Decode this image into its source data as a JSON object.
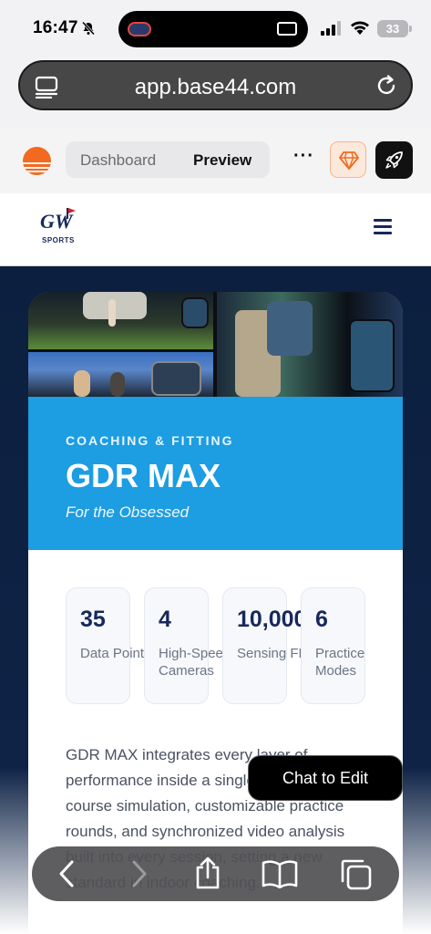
{
  "status_bar": {
    "time": "16:47",
    "battery": "33",
    "icons": [
      "bell-slash-icon",
      "cellular-signal-icon",
      "wifi-icon",
      "battery-icon"
    ]
  },
  "browser": {
    "url": "app.base44.com",
    "icons": [
      "tabs-icon",
      "reload-icon"
    ]
  },
  "app_toolbar": {
    "tabs": [
      {
        "label": "Dashboard",
        "active": false
      },
      {
        "label": "Preview",
        "active": true
      }
    ],
    "more_label": "···",
    "accent": "#f26a1f"
  },
  "site_header": {
    "logo_text": "GW",
    "logo_sub": "SPORTS",
    "menu_icon": "hamburger-menu-icon",
    "brand_color": "#17285a"
  },
  "hero": {
    "eyebrow": "COACHING & FITTING",
    "title": "GDR MAX",
    "tagline": "For the Obsessed",
    "banner_color": "#1d9de2"
  },
  "stats": [
    {
      "value": "35",
      "label": "Data Points"
    },
    {
      "value": "4",
      "label": "High-Speed Cameras"
    },
    {
      "value": "10,000",
      "label": "Sensing FPS"
    },
    {
      "value": "6",
      "label": "Practice Modes"
    }
  ],
  "description": "GDR MAX integrates every layer of performance inside a single system — real-course simulation, customizable practice rounds, and synchronized video analysis built into every session, setting a new standard in indoor coaching.",
  "chat_button": "Chat to Edit",
  "bottom_nav": [
    "back-icon",
    "forward-icon",
    "share-icon",
    "bookmarks-icon",
    "tabs-icon"
  ]
}
